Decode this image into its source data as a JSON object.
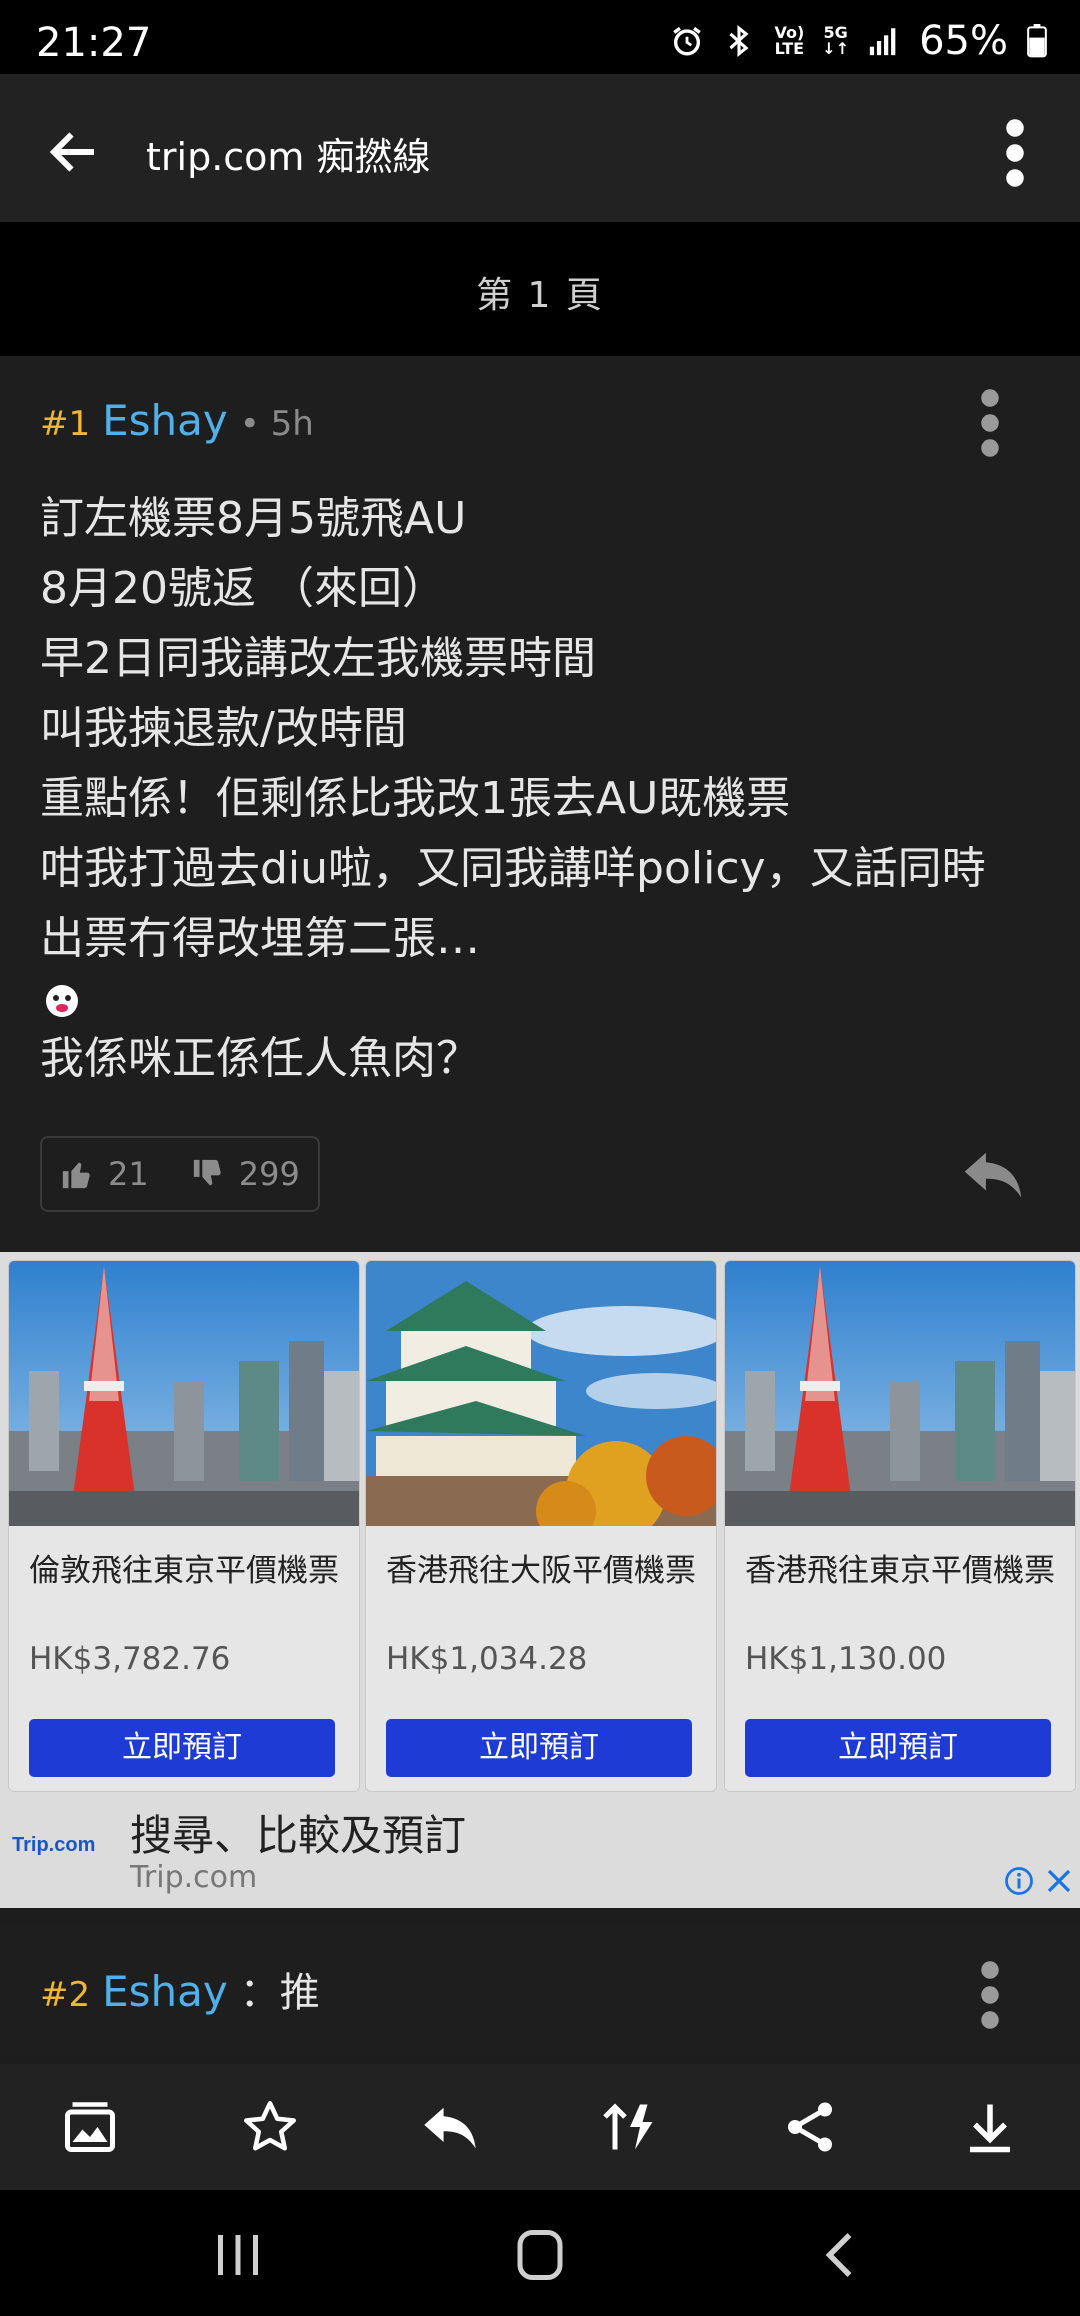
{
  "status_bar": {
    "time": "21:27",
    "battery_percent": "65%",
    "volte_top": "Vo)",
    "volte_bottom": "LTE",
    "network": "5G",
    "icons": [
      "alarm-icon",
      "bluetooth-icon",
      "volte-icon",
      "5g-icon",
      "signal-icon",
      "battery-icon"
    ]
  },
  "app_bar": {
    "title": "trip.com 痴撚線",
    "icons": [
      "back-arrow-icon",
      "more-vert-icon"
    ]
  },
  "page_header": {
    "label": "第 1 頁"
  },
  "post1": {
    "number": "#1",
    "username": "Eshay",
    "time": "• 5h",
    "lines": [
      "訂左機票8月5號飛AU",
      "8月20號返 （來回）",
      "早2日同我講改左我機票時間",
      "叫我揀退款/改時間",
      "重點係！佢剩係比我改1張去AU既機票",
      "咁我打過去diu啦，又同我講咩policy，又話同時",
      "出票冇得改埋第二張…",
      "我係咪正係任人魚肉？"
    ],
    "likes": "21",
    "dislikes": "299"
  },
  "ad": {
    "cards": [
      {
        "title": "倫敦飛往東京平價機票",
        "price": "HK$3,782.76",
        "button": "立即預訂",
        "image": "tokyo-tower-photo"
      },
      {
        "title": "香港飛往大阪平價機票",
        "price": "HK$1,034.28",
        "button": "立即預訂",
        "image": "osaka-castle-photo"
      },
      {
        "title": "香港飛往東京平價機票",
        "price": "HK$1,130.00",
        "button": "立即預訂",
        "image": "tokyo-tower-photo"
      }
    ],
    "logo": "Trip.com",
    "headline": "搜尋、比較及預訂",
    "domain": "Trip.com"
  },
  "post2": {
    "number": "#2",
    "username": "Eshay",
    "text": "：推"
  },
  "toolbar": {
    "icons": [
      "gallery-icon",
      "star-icon",
      "reply-icon",
      "sort-icon",
      "share-icon",
      "download-icon"
    ]
  },
  "colors": {
    "post_number": "#f2b632",
    "username": "#4fb0ea",
    "ad_button": "#1e3bd6",
    "background": "#1d1d1d"
  }
}
